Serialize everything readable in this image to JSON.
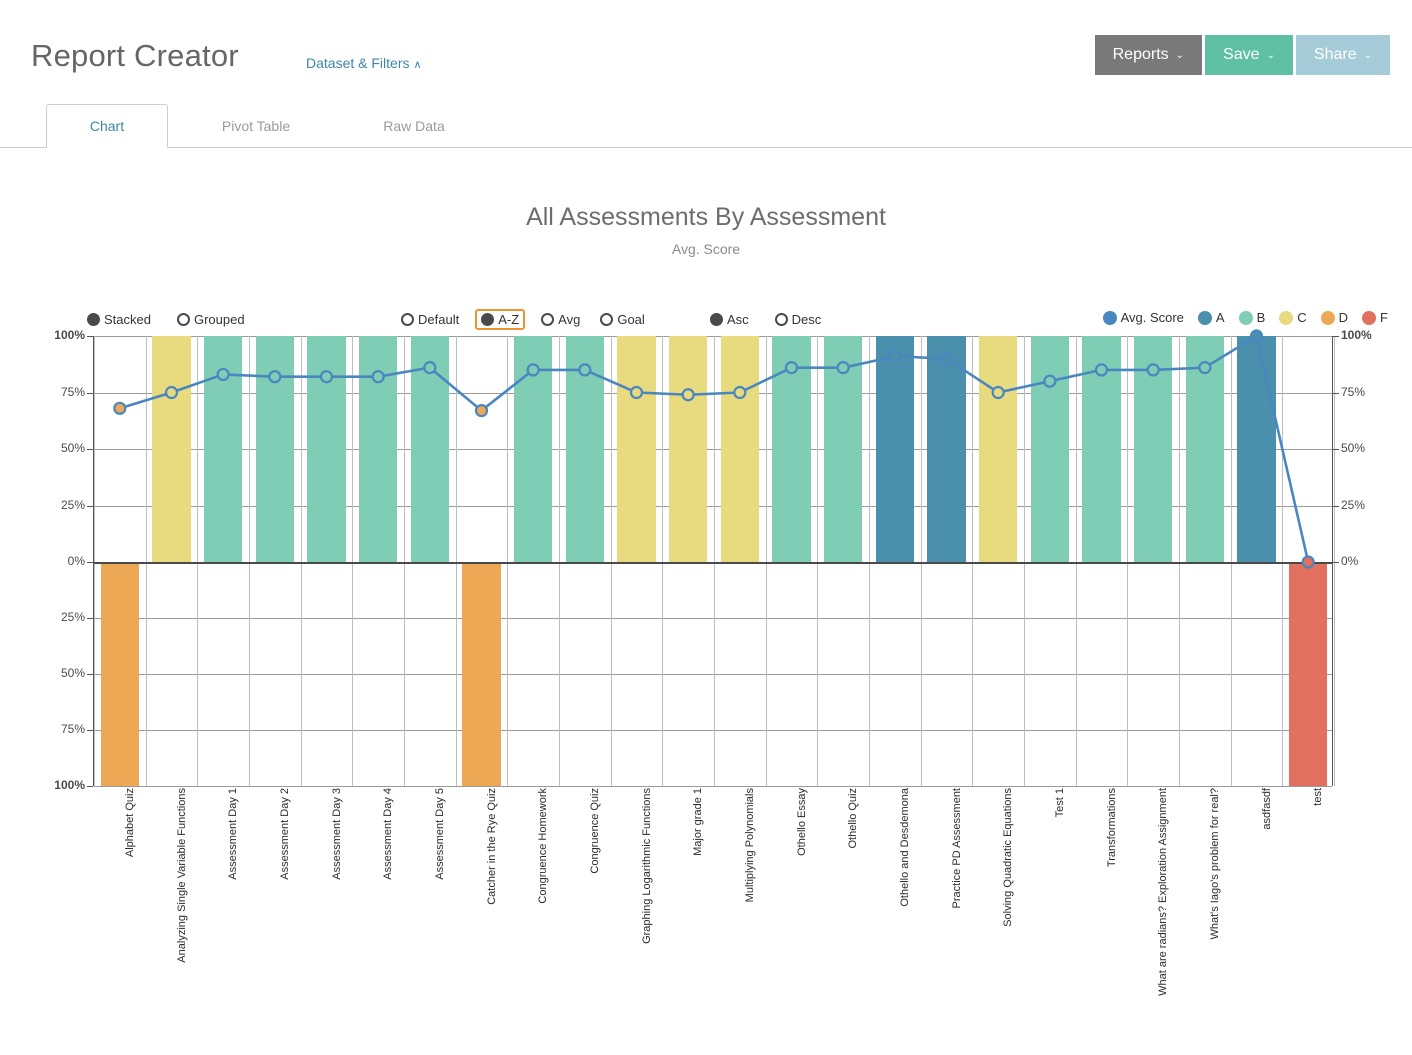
{
  "header": {
    "app_title": "Report Creator",
    "dataset_filters_label": "Dataset & Filters",
    "dataset_filters_caret": "∧",
    "buttons": [
      {
        "label": "Reports",
        "caret": "⌄",
        "color": "#797979",
        "name": "reports-button"
      },
      {
        "label": "Save",
        "caret": "⌄",
        "color": "#5fc0a4",
        "name": "save-button"
      },
      {
        "label": "Share",
        "caret": "⌄",
        "color": "#a5cad8",
        "name": "share-button"
      }
    ]
  },
  "tabs": [
    {
      "label": "Chart",
      "active": true
    },
    {
      "label": "Pivot Table",
      "active": false
    },
    {
      "label": "Raw Data",
      "active": false
    }
  ],
  "controls": {
    "stacking": {
      "options": [
        "Stacked",
        "Grouped"
      ],
      "selected": "Stacked"
    },
    "sorting": {
      "options": [
        "Default",
        "A-Z",
        "Avg",
        "Goal"
      ],
      "selected": "A-Z",
      "highlighted": "A-Z"
    },
    "order": {
      "options": [
        "Asc",
        "Desc"
      ],
      "selected": "Asc"
    }
  },
  "chart_data": {
    "type": "bar",
    "title": "All Assessments By Assessment",
    "subtitle": "Avg. Score",
    "xlabel": "",
    "ylabel": "",
    "ylim": [
      0,
      100
    ],
    "y_ticks_top": [
      "100%",
      "75%",
      "50%",
      "25%",
      "0%"
    ],
    "y_ticks_bottom": [
      "25%",
      "50%",
      "75%",
      "100%"
    ],
    "grid": true,
    "legend_position": "top-right",
    "legend": [
      {
        "name": "Avg. Score",
        "color": "#4a86c0"
      },
      {
        "name": "A",
        "color": "#4a8fac"
      },
      {
        "name": "B",
        "color": "#7fcdb5"
      },
      {
        "name": "C",
        "color": "#e8da7f"
      },
      {
        "name": "D",
        "color": "#eda856"
      },
      {
        "name": "F",
        "color": "#e2705e"
      }
    ],
    "categories": [
      "Alphabet Quiz",
      "Analyzing Single Variable Functions",
      "Assessment Day 1",
      "Assessment Day 2",
      "Assessment Day 3",
      "Assessment Day 4",
      "Assessment Day 5",
      "Catcher in the Rye Quiz",
      "Congruence Homework",
      "Congruence Quiz",
      "Graphing Logarithmic Functions",
      "Major grade 1",
      "Multiplying Polynomials",
      "Othello Essay",
      "Othello Quiz",
      "Othello and Desdemona",
      "Practice PD Assessment",
      "Solving Quadratic Equations",
      "Test 1",
      "Transformations",
      "What are radians? Exploration Assignment",
      "What's Iago's problem for real?",
      "asdfasdf",
      "test"
    ],
    "series": [
      {
        "name": "Avg. Score",
        "type": "line",
        "values": [
          68,
          75,
          83,
          82,
          82,
          82,
          86,
          67,
          85,
          85,
          75,
          74,
          75,
          86,
          86,
          91,
          90,
          75,
          80,
          85,
          85,
          86,
          100,
          0
        ]
      },
      {
        "name": "Grade band (100% stacked bar)",
        "type": "bar",
        "grades": [
          "D",
          "C",
          "B",
          "B",
          "B",
          "B",
          "B",
          "D",
          "B",
          "B",
          "C",
          "C",
          "C",
          "B",
          "B",
          "A",
          "A",
          "C",
          "B",
          "B",
          "B",
          "B",
          "A",
          "F"
        ],
        "directions": [
          "down",
          "up",
          "up",
          "up",
          "up",
          "up",
          "up",
          "down",
          "up",
          "up",
          "up",
          "up",
          "up",
          "up",
          "up",
          "up",
          "up",
          "up",
          "up",
          "up",
          "up",
          "up",
          "up",
          "down"
        ],
        "values": [
          100,
          100,
          100,
          100,
          100,
          100,
          100,
          100,
          100,
          100,
          100,
          100,
          100,
          100,
          100,
          100,
          100,
          100,
          100,
          100,
          100,
          100,
          100,
          100
        ]
      }
    ]
  }
}
